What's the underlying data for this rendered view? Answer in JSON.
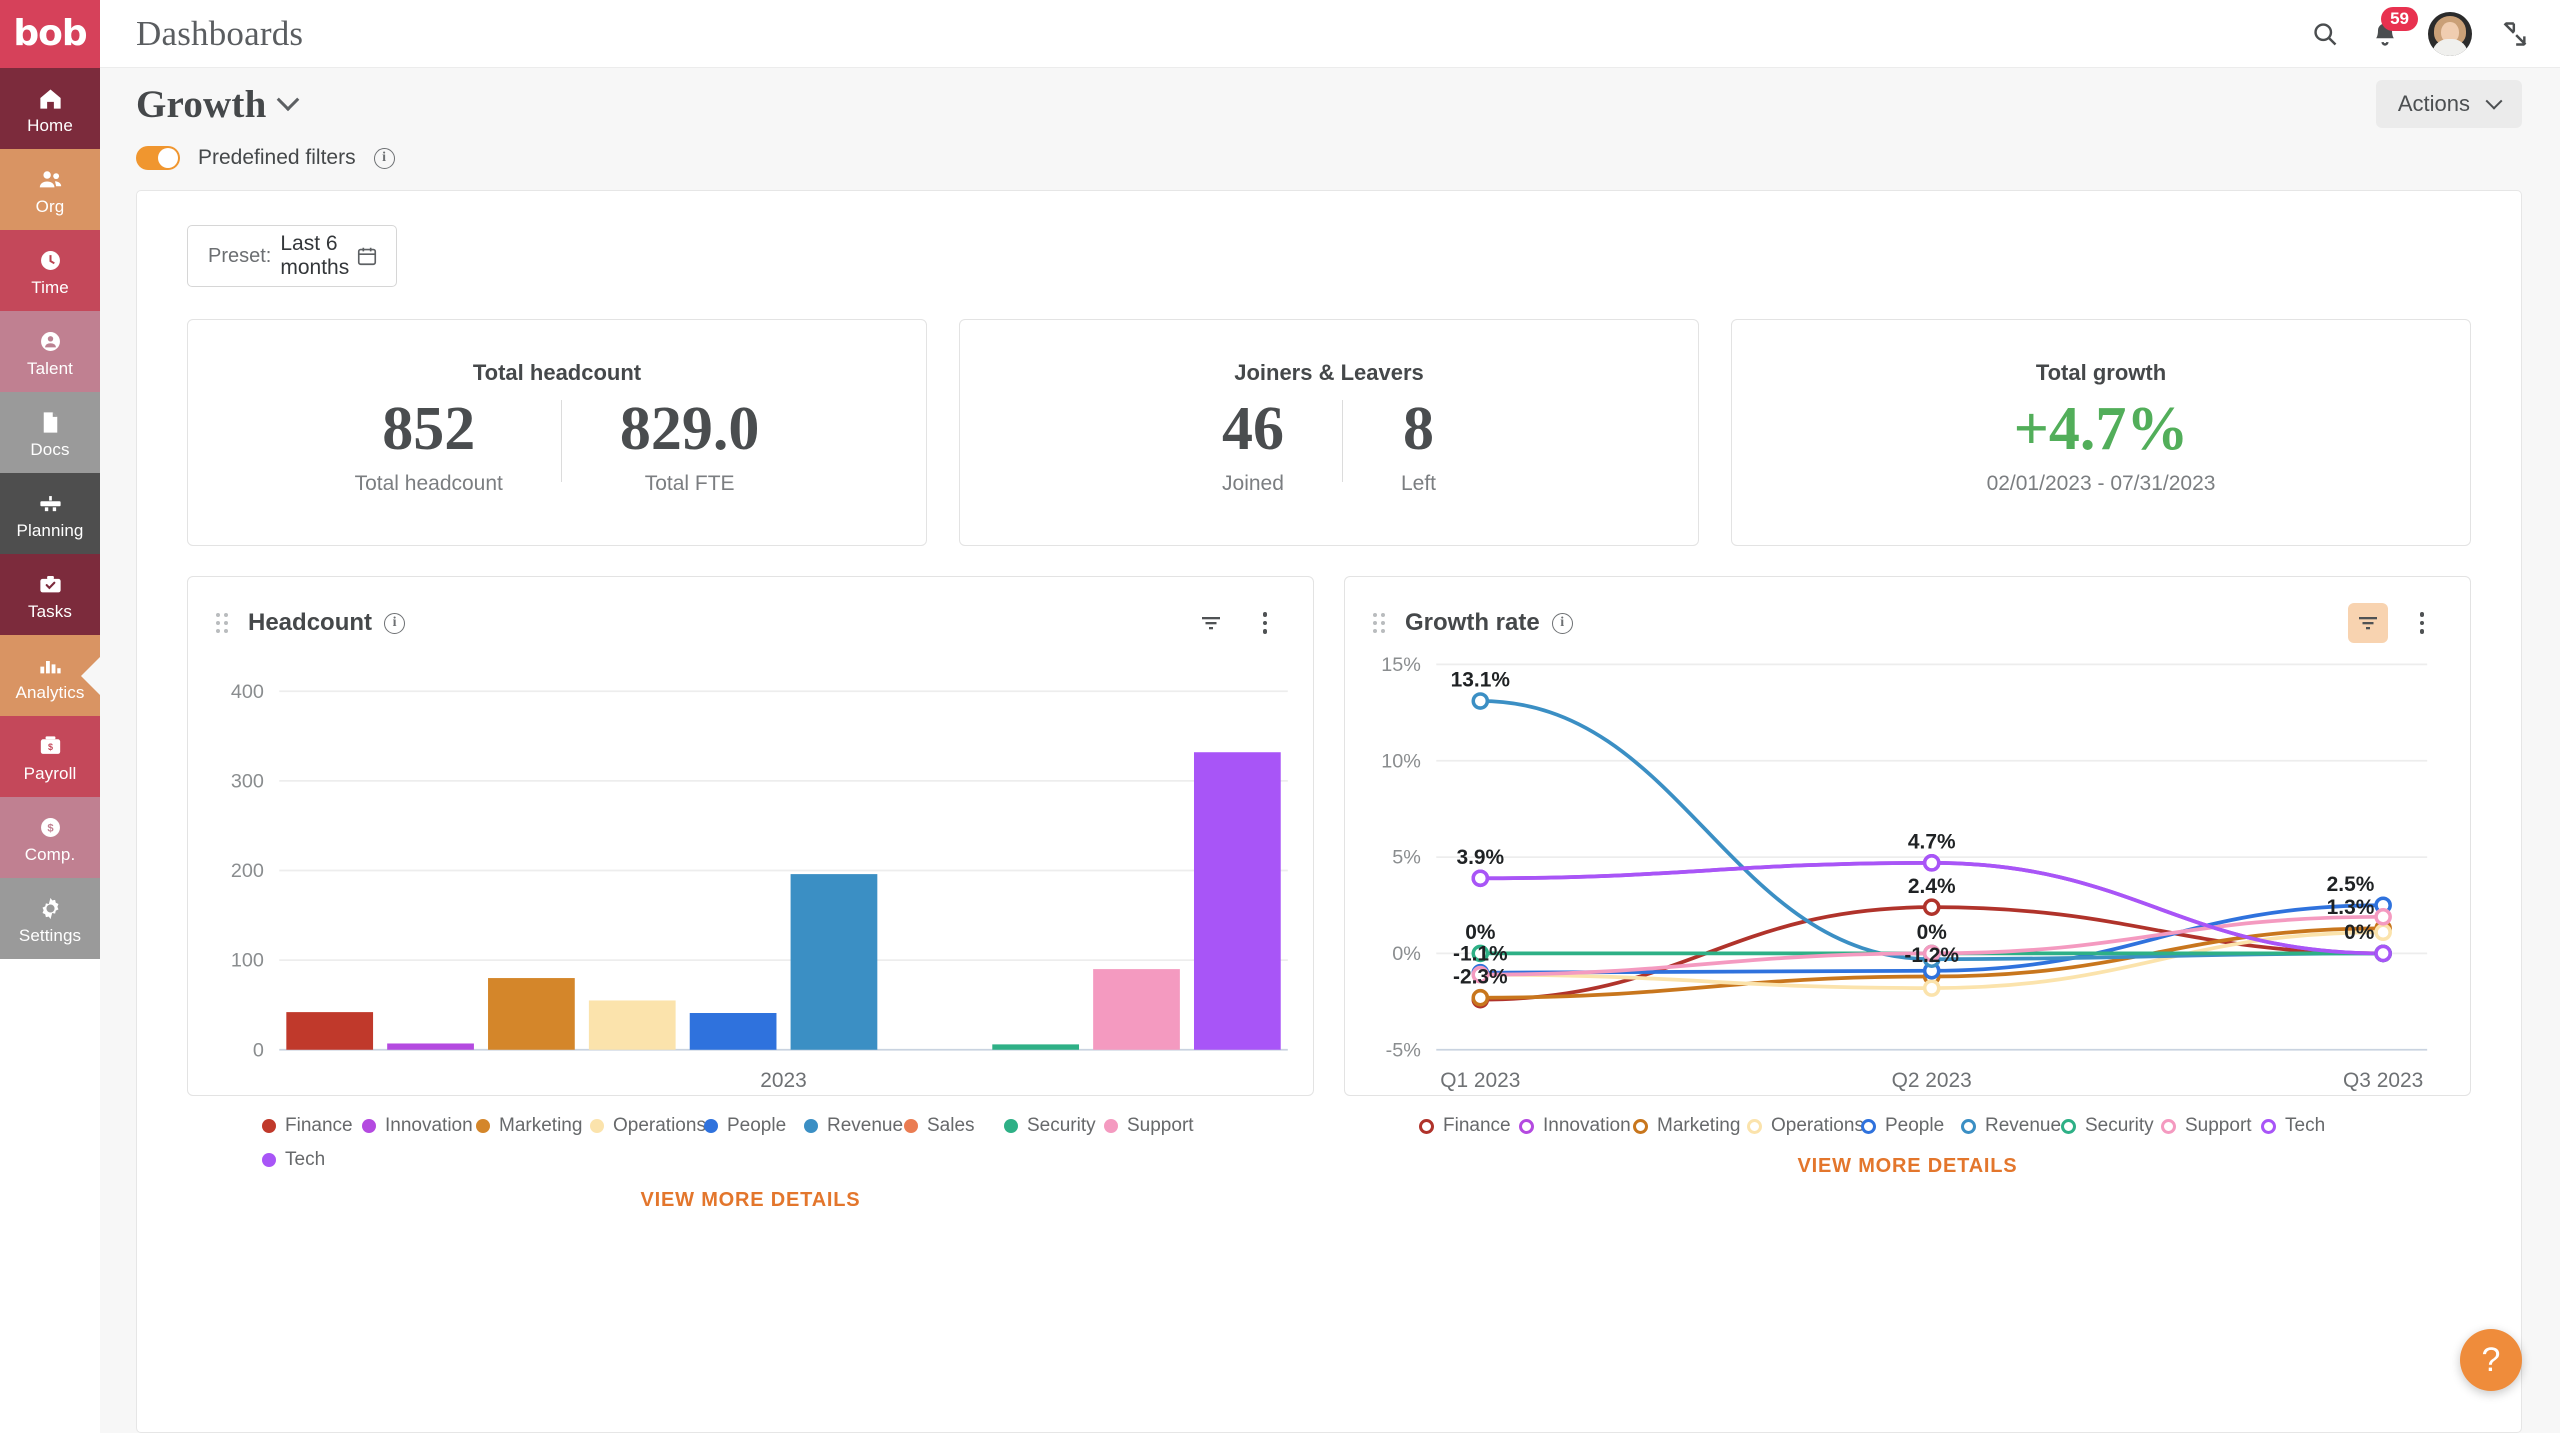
{
  "brand": {
    "logo_text": "bob",
    "accent": "#d6415a",
    "orange": "#ef8c3b",
    "link_orange": "#e3762c",
    "green": "#52ae5a"
  },
  "sidebar": {
    "items": [
      {
        "label": "Home",
        "icon": "home-icon",
        "color": "#7c2b3c",
        "active": false
      },
      {
        "label": "Org",
        "icon": "people-icon",
        "color": "#d99463",
        "active": false
      },
      {
        "label": "Time",
        "icon": "clock-icon",
        "color": "#c4485a",
        "active": false
      },
      {
        "label": "Talent",
        "icon": "person-icon",
        "color": "#c08091",
        "active": false
      },
      {
        "label": "Docs",
        "icon": "document-icon",
        "color": "#9a9a9a",
        "active": false
      },
      {
        "label": "Planning",
        "icon": "planning-icon",
        "color": "#4e4e4e",
        "active": false
      },
      {
        "label": "Tasks",
        "icon": "tasks-icon",
        "color": "#7c2b3c",
        "active": false
      },
      {
        "label": "Analytics",
        "icon": "bar-chart-icon",
        "color": "#d99463",
        "active": true
      },
      {
        "label": "Payroll",
        "icon": "payroll-icon",
        "color": "#c4485a",
        "active": false
      },
      {
        "label": "Comp.",
        "icon": "dollar-icon",
        "color": "#c08091",
        "active": false
      },
      {
        "label": "Settings",
        "icon": "gear-icon",
        "color": "#9a9a9a",
        "active": false
      }
    ]
  },
  "topbar": {
    "title": "Dashboards",
    "search_icon": "search-icon",
    "bell_icon": "bell-icon",
    "notification_count": "59",
    "avatar": "user-avatar",
    "collapse_icon": "collapse-icon"
  },
  "page": {
    "title": "Growth",
    "title_chevron": "chevron-down-icon",
    "actions_label": "Actions",
    "predefined_filters_label": "Predefined filters",
    "info_icon": "info-icon"
  },
  "preset": {
    "label": "Preset:",
    "value": "Last 6 months",
    "calendar_icon": "calendar-icon"
  },
  "kpis": [
    {
      "title": "Total headcount",
      "metrics": [
        {
          "value": "852",
          "label": "Total headcount"
        },
        {
          "value": "829.0",
          "label": "Total FTE"
        }
      ]
    },
    {
      "title": "Joiners & Leavers",
      "metrics": [
        {
          "value": "46",
          "label": "Joined"
        },
        {
          "value": "8",
          "label": "Left"
        }
      ]
    },
    {
      "title": "Total growth",
      "metrics": [
        {
          "value": "+4.7%",
          "label": "02/01/2023 - 07/31/2023",
          "accent": "green"
        }
      ]
    }
  ],
  "cards": {
    "headcount": {
      "title": "Headcount",
      "filter_icon": "filter-icon",
      "menu_icon": "more-vertical-icon",
      "filter_active": false,
      "view_more": "VIEW MORE DETAILS"
    },
    "growth_rate": {
      "title": "Growth rate",
      "filter_icon": "filter-icon",
      "menu_icon": "more-vertical-icon",
      "filter_active": true,
      "view_more": "VIEW MORE DETAILS"
    }
  },
  "help_fab": {
    "glyph": "?",
    "name": "help-button"
  },
  "chart_data": [
    {
      "type": "bar",
      "title": "Headcount",
      "xlabel": "2023",
      "ylabel": "",
      "ylim": [
        0,
        430
      ],
      "yticks": [
        0,
        100,
        200,
        300,
        400
      ],
      "ytick_labels": [
        "0",
        "100",
        "200",
        "300",
        "400"
      ],
      "xtick_labels": [
        "2023"
      ],
      "grid": true,
      "legend_position": "bottom",
      "categories": [
        "Finance",
        "Innovation",
        "Marketing",
        "Operations",
        "People",
        "Revenue",
        "Sales",
        "Security",
        "Support",
        "Tech"
      ],
      "values": [
        42,
        7,
        80,
        55,
        41,
        196,
        0,
        6,
        90,
        332
      ],
      "colors": [
        "#c0392b",
        "#b44ae0",
        "#d4862a",
        "#fbe3ac",
        "#2f72dd",
        "#3b8fc4",
        "#ea7c52",
        "#2eb086",
        "#f49ac0",
        "#a855f7"
      ]
    },
    {
      "type": "line",
      "title": "Growth rate",
      "xlabel": "",
      "ylabel": "",
      "ylim": [
        -5,
        15
      ],
      "yticks": [
        -5,
        0,
        5,
        10,
        15
      ],
      "ytick_labels": [
        "-5%",
        "0%",
        "5%",
        "10%",
        "15%"
      ],
      "x": [
        "Q1 2023",
        "Q2 2023",
        "Q3 2023"
      ],
      "grid": true,
      "legend_position": "bottom",
      "series": [
        {
          "name": "Finance",
          "color": "#b0332b",
          "values": [
            -2.4,
            2.4,
            0.0
          ],
          "labels": [
            "",
            "2.4%",
            ""
          ]
        },
        {
          "name": "Innovation",
          "color": "#b44ae0",
          "values": [
            3.9,
            4.7,
            0.0
          ],
          "labels": [
            "3.9%",
            "4.7%",
            ""
          ]
        },
        {
          "name": "Marketing",
          "color": "#c8761d",
          "values": [
            -2.3,
            -1.2,
            1.3
          ],
          "labels": [
            "-2.3%",
            "-1.2%",
            "1.3%"
          ]
        },
        {
          "name": "Operations",
          "color": "#fbe3ac",
          "values": [
            -1.1,
            -1.8,
            1.1
          ],
          "labels": [
            "",
            "",
            ""
          ]
        },
        {
          "name": "People",
          "color": "#2f72dd",
          "values": [
            -1.0,
            -0.9,
            2.5
          ],
          "labels": [
            "",
            "",
            "2.5%"
          ]
        },
        {
          "name": "Revenue",
          "color": "#3b8fc4",
          "values": [
            13.1,
            -0.3,
            0.0
          ],
          "labels": [
            "13.1%",
            "",
            ""
          ]
        },
        {
          "name": "Security",
          "color": "#2eb086",
          "values": [
            0.0,
            0.0,
            0.0
          ],
          "labels": [
            "0%",
            "",
            ""
          ]
        },
        {
          "name": "Support",
          "color": "#f49ac0",
          "values": [
            -1.1,
            0.0,
            1.9
          ],
          "labels": [
            "-1.1%",
            "0%",
            ""
          ]
        },
        {
          "name": "Tech",
          "color": "#a855f7",
          "values": [
            3.9,
            4.7,
            0.0
          ],
          "labels": [
            "",
            "",
            "0%"
          ]
        }
      ]
    }
  ],
  "legends": {
    "headcount": [
      {
        "label": "Finance",
        "color": "#c0392b"
      },
      {
        "label": "Innovation",
        "color": "#b44ae0"
      },
      {
        "label": "Marketing",
        "color": "#d4862a"
      },
      {
        "label": "Operations",
        "color": "#fbe3ac"
      },
      {
        "label": "People",
        "color": "#2f72dd"
      },
      {
        "label": "Revenue",
        "color": "#3b8fc4"
      },
      {
        "label": "Sales",
        "color": "#ea7c52"
      },
      {
        "label": "Security",
        "color": "#2eb086"
      },
      {
        "label": "Support",
        "color": "#f49ac0"
      },
      {
        "label": "Tech",
        "color": "#a855f7"
      }
    ],
    "growth_rate": [
      {
        "label": "Finance",
        "color": "#b0332b"
      },
      {
        "label": "Innovation",
        "color": "#b44ae0"
      },
      {
        "label": "Marketing",
        "color": "#c8761d"
      },
      {
        "label": "Operations",
        "color": "#fbe3ac"
      },
      {
        "label": "People",
        "color": "#2f72dd"
      },
      {
        "label": "Revenue",
        "color": "#3b8fc4"
      },
      {
        "label": "Security",
        "color": "#2eb086"
      },
      {
        "label": "Support",
        "color": "#f49ac0"
      },
      {
        "label": "Tech",
        "color": "#a855f7"
      }
    ]
  }
}
